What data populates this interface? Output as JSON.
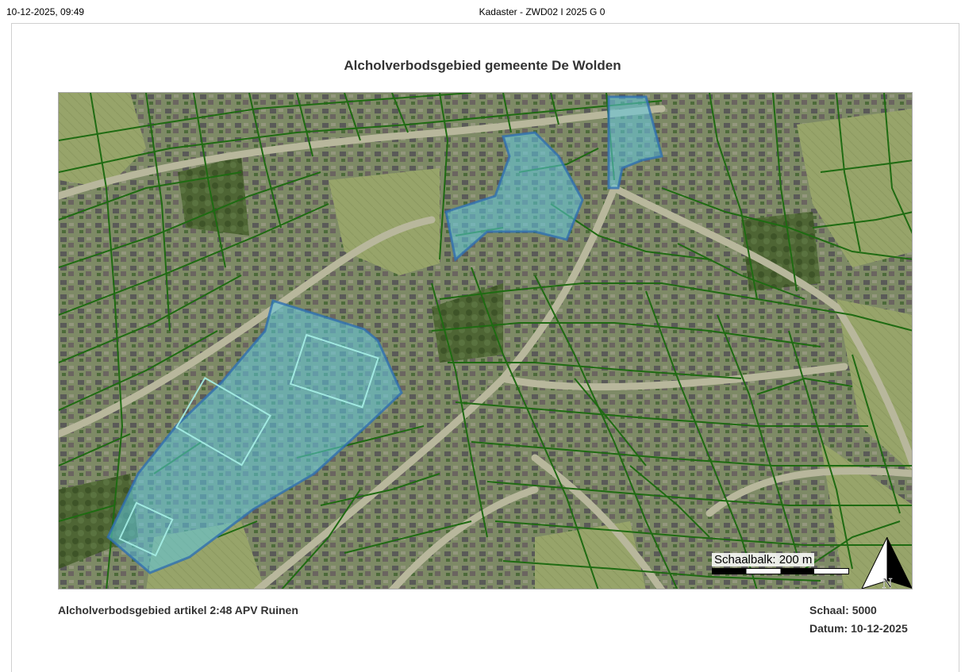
{
  "print_header": {
    "datetime": "10-12-2025, 09:49",
    "title": "Kadaster - ZWD02 I 2025 G 0"
  },
  "map": {
    "title": "Alcholverbodsgebied gemeente De Wolden",
    "layers": [
      "aerial-photo",
      "cadastral-parcel-boundaries",
      "alcohol-ban-zones"
    ],
    "parcel_line_color": "#1f6b12",
    "zone_fill_color": "#5ec8e0",
    "zone_border_color": "#2f6fb0",
    "scalebar": {
      "label": "Schaalbalk: 200 m"
    },
    "north_arrow": {
      "label": "N"
    }
  },
  "footer": {
    "legend": "Alcholverbodsgebied artikel 2:48 APV Ruinen",
    "scale": "Schaal: 5000",
    "date": "Datum: 10-12-2025"
  }
}
